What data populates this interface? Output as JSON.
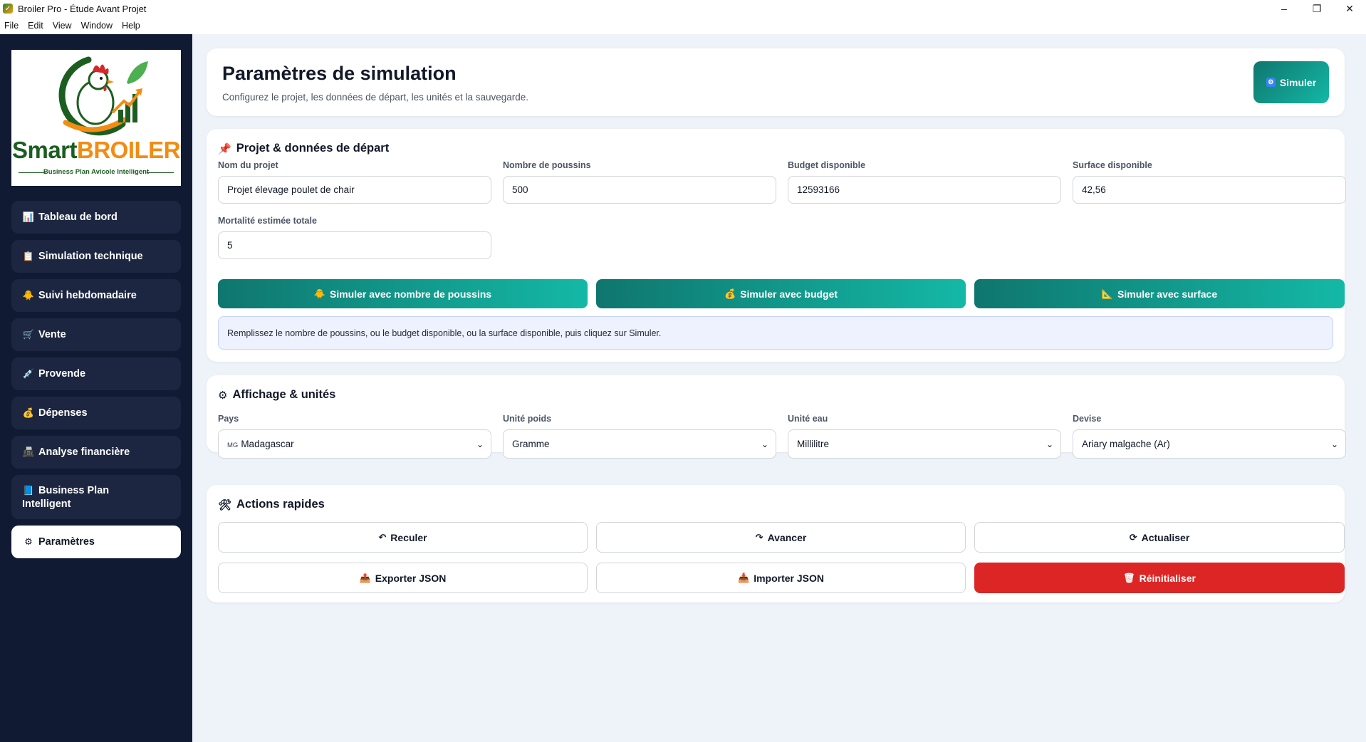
{
  "window": {
    "title": "Broiler Pro - Étude Avant Projet",
    "controls": {
      "minimize": "–",
      "restore": "❐",
      "close": "✕"
    }
  },
  "menu": [
    "File",
    "Edit",
    "View",
    "Window",
    "Help"
  ],
  "brand": {
    "name_part1": "Smart",
    "name_part2": "BROILER",
    "tagline": "Business Plan Avicole Intelligent",
    "colors": {
      "green": "#1b5e20",
      "orange": "#f28c13"
    }
  },
  "sidebar": {
    "items": [
      {
        "icon": "bar-chart-icon",
        "glyph": "📊",
        "label": "Tableau de bord"
      },
      {
        "icon": "clipboard-icon",
        "glyph": "📋",
        "label": "Simulation technique"
      },
      {
        "icon": "chick-icon",
        "glyph": "🐥",
        "label": "Suivi hebdomadaire"
      },
      {
        "icon": "cart-icon",
        "glyph": "🛒",
        "label": "Vente"
      },
      {
        "icon": "syringe-icon",
        "glyph": "💉",
        "label": "Provende"
      },
      {
        "icon": "money-bag-icon",
        "glyph": "💰",
        "label": "Dépenses"
      },
      {
        "icon": "fax-icon",
        "glyph": "📠",
        "label": "Analyse financière"
      },
      {
        "icon": "book-icon",
        "glyph": "📘",
        "label": "Business Plan Intelligent"
      },
      {
        "icon": "gear-icon",
        "glyph": "⚙",
        "label": "Paramètres",
        "active": true
      }
    ]
  },
  "header": {
    "title": "Paramètres de simulation",
    "subtitle": "Configurez le projet, les données de départ, les unités et la sauvegarde.",
    "simulate_button": "Simuler"
  },
  "project": {
    "section_title": "Projet & données de départ",
    "section_icon": "📌",
    "fields": {
      "project_name": {
        "label": "Nom du projet",
        "value": "Projet élevage poulet de chair"
      },
      "chicks": {
        "label": "Nombre de poussins",
        "value": "500"
      },
      "budget": {
        "label": "Budget disponible",
        "value": "12593166"
      },
      "surface": {
        "label": "Surface disponible",
        "value": "42,56"
      },
      "mortality": {
        "label": "Mortalité estimée totale",
        "value": "5"
      }
    },
    "buttons": {
      "by_chicks": {
        "glyph": "🐥",
        "label": "Simuler avec nombre de poussins"
      },
      "by_budget": {
        "glyph": "💰",
        "label": "Simuler avec budget"
      },
      "by_surface": {
        "glyph": "📐",
        "label": "Simuler avec surface"
      }
    },
    "info": "Remplissez le nombre de poussins, ou le budget disponible, ou la surface disponible, puis cliquez sur Simuler."
  },
  "display": {
    "section_title": "Affichage & unités",
    "section_icon": "⚙",
    "fields": {
      "country": {
        "label": "Pays",
        "flag": "MG",
        "value": "Madagascar"
      },
      "weight_unit": {
        "label": "Unité poids",
        "value": "Gramme"
      },
      "water_unit": {
        "label": "Unité eau",
        "value": "Millilitre"
      },
      "currency": {
        "label": "Devise",
        "value": "Ariary malgache (Ar)"
      }
    }
  },
  "actions": {
    "section_title": "Actions rapides",
    "section_icon": "🛠",
    "buttons": {
      "undo": {
        "glyph": "↶",
        "label": "Reculer"
      },
      "redo": {
        "glyph": "↷",
        "label": "Avancer"
      },
      "refresh": {
        "glyph": "⟳",
        "label": "Actualiser"
      },
      "export": {
        "glyph": "📤",
        "label": "Exporter JSON"
      },
      "import": {
        "glyph": "📥",
        "label": "Importer JSON"
      },
      "reset": {
        "glyph": "🗑",
        "label": "Réinitialiser"
      }
    }
  },
  "colors": {
    "sidebar_bg": "#101a33",
    "nav_item_bg": "#1c2640",
    "main_bg": "#eef2f9",
    "teal_start": "#0f766e",
    "teal_end": "#14b8a6",
    "danger": "#dc2626"
  }
}
